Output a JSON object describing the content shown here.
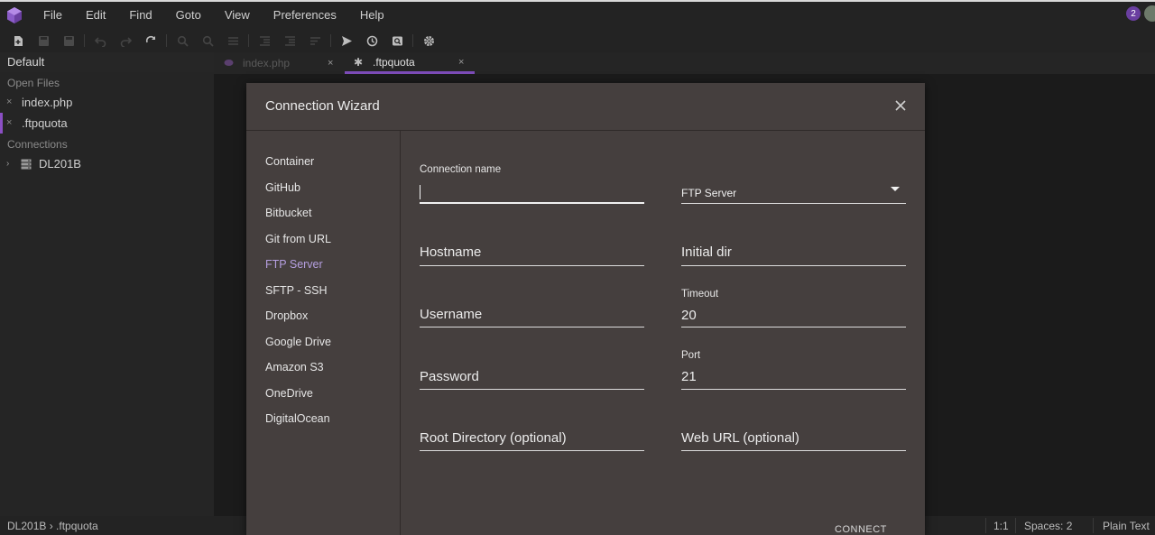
{
  "menubar": {
    "items": [
      "File",
      "Edit",
      "Find",
      "Goto",
      "View",
      "Preferences",
      "Help"
    ],
    "notification_count": "2"
  },
  "toolbar": {
    "icons": [
      "new-file-icon",
      "save-icon",
      "save-all-icon",
      "undo-icon",
      "redo-icon",
      "reload-icon",
      "search-icon",
      "search-replace-icon",
      "list-icon",
      "indent-icon",
      "outdent-icon",
      "sort-icon",
      "send-icon",
      "history-icon",
      "preview-icon",
      "settings-icon"
    ]
  },
  "sidebar": {
    "project": "Default",
    "open_files_header": "Open Files",
    "open_files": [
      {
        "name": "index.php",
        "close": "×"
      },
      {
        "name": ".ftpquota",
        "close": "×"
      }
    ],
    "connections_header": "Connections",
    "connections": [
      {
        "name": "DL201B",
        "chevron": "›"
      }
    ]
  },
  "tabs": [
    {
      "label": "index.php",
      "close": "×",
      "state": "inactive"
    },
    {
      "label": ".ftpquota",
      "close": "×",
      "state": "active"
    }
  ],
  "dialog": {
    "title": "Connection Wizard",
    "nav": [
      "Container",
      "GitHub",
      "Bitbucket",
      "Git from URL",
      "FTP Server",
      "SFTP - SSH",
      "Dropbox",
      "Google Drive",
      "Amazon S3",
      "OneDrive",
      "DigitalOcean"
    ],
    "selected_nav": "FTP Server",
    "fields": {
      "connection_name_label": "Connection name",
      "connection_name_value": "",
      "server_type": "FTP Server",
      "hostname": "Hostname",
      "initial_dir": "Initial dir",
      "username": "Username",
      "timeout_label": "Timeout",
      "timeout_value": "20",
      "password": "Password",
      "port_label": "Port",
      "port_value": "21",
      "root_directory": "Root Directory (optional)",
      "web_url": "Web URL (optional)"
    },
    "connect_button": "CONNECT"
  },
  "statusbar": {
    "path": "DL201B › .ftpquota",
    "position": "1:1",
    "spaces": "Spaces: 2",
    "mode": "Plain Text"
  },
  "colors": {
    "accent": "#7d4cb8",
    "dialog_bg": "#453f3e",
    "selected_nav": "#b59fe0"
  }
}
